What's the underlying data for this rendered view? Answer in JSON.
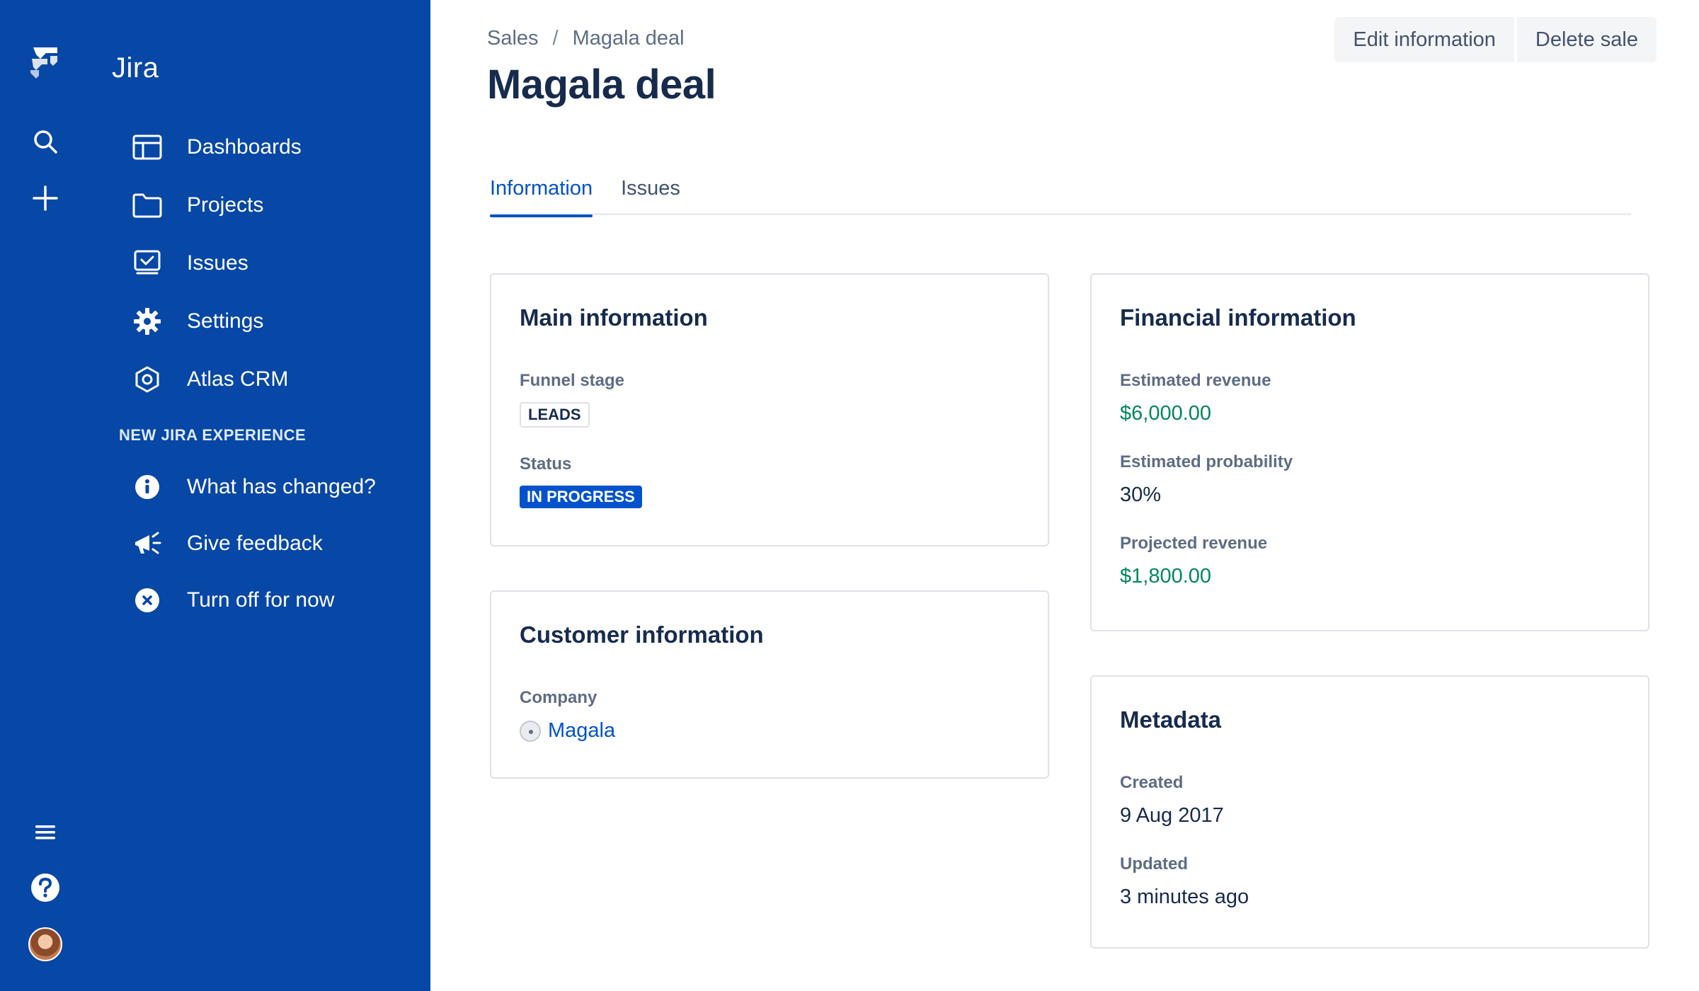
{
  "app": {
    "name": "Jira"
  },
  "sidebar": {
    "items": [
      {
        "label": "Dashboards",
        "icon": "dashboard-icon"
      },
      {
        "label": "Projects",
        "icon": "folder-icon"
      },
      {
        "label": "Issues",
        "icon": "issues-icon"
      },
      {
        "label": "Settings",
        "icon": "gear-icon"
      },
      {
        "label": "Atlas CRM",
        "icon": "hexagon-icon"
      }
    ],
    "section_heading": "NEW JIRA EXPERIENCE",
    "experience_items": [
      {
        "label": "What has changed?",
        "icon": "info-icon"
      },
      {
        "label": "Give feedback",
        "icon": "megaphone-icon"
      },
      {
        "label": "Turn off for now",
        "icon": "close-circle-icon"
      }
    ]
  },
  "header": {
    "breadcrumb": [
      "Sales",
      "Magala deal"
    ],
    "breadcrumb_sep": "/",
    "title": "Magala deal",
    "actions": {
      "edit": "Edit information",
      "delete": "Delete sale"
    }
  },
  "tabs": [
    {
      "label": "Information",
      "active": true
    },
    {
      "label": "Issues",
      "active": false
    }
  ],
  "main_info": {
    "title": "Main information",
    "funnel_stage_label": "Funnel stage",
    "funnel_stage": "LEADS",
    "status_label": "Status",
    "status": "IN PROGRESS"
  },
  "customer_info": {
    "title": "Customer information",
    "company_label": "Company",
    "company": "Magala"
  },
  "financial_info": {
    "title": "Financial information",
    "estimated_revenue_label": "Estimated revenue",
    "estimated_revenue": "$6,000.00",
    "estimated_probability_label": "Estimated probability",
    "estimated_probability": "30%",
    "projected_revenue_label": "Projected revenue",
    "projected_revenue": "$1,800.00"
  },
  "metadata": {
    "title": "Metadata",
    "created_label": "Created",
    "created": "9 Aug 2017",
    "updated_label": "Updated",
    "updated": "3 minutes ago"
  },
  "colors": {
    "sidebar": "#0747a6",
    "primary": "#0052cc",
    "money": "#00875a",
    "text": "#172b4d",
    "subtle": "#5e6c84"
  }
}
